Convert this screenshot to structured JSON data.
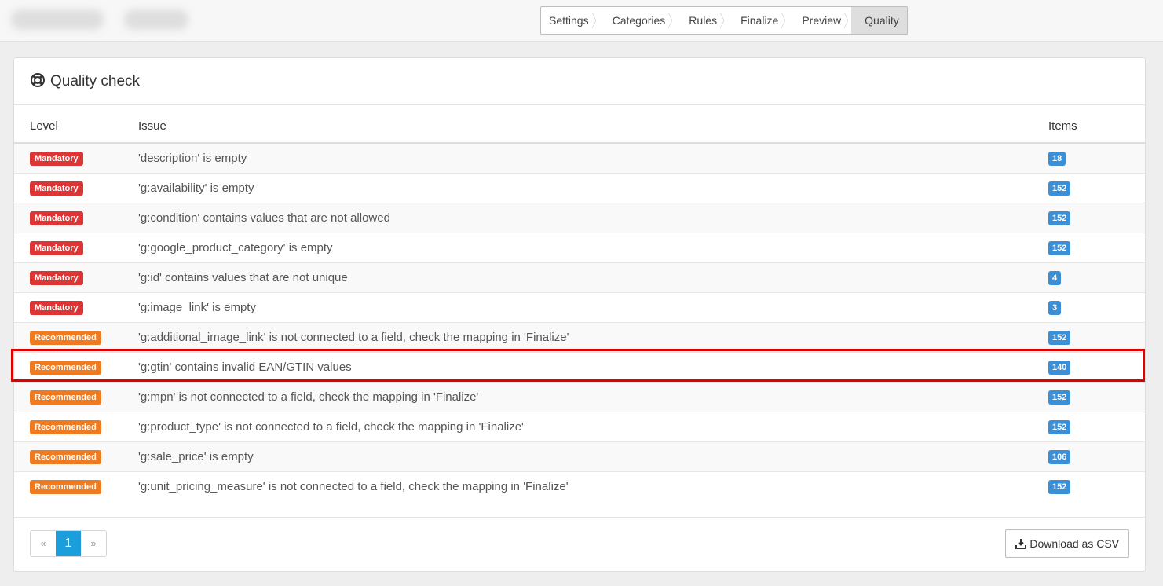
{
  "steps": [
    "Settings",
    "Categories",
    "Rules",
    "Finalize",
    "Preview",
    "Quality"
  ],
  "active_step": "Quality",
  "panel": {
    "title": "Quality check",
    "icon": "lifebuoy-icon"
  },
  "table": {
    "headers": {
      "level": "Level",
      "issue": "Issue",
      "items": "Items"
    },
    "rows": [
      {
        "level": "Mandatory",
        "issue": "'description' is empty",
        "items": "18"
      },
      {
        "level": "Mandatory",
        "issue": "'g:availability' is empty",
        "items": "152"
      },
      {
        "level": "Mandatory",
        "issue": "'g:condition' contains values that are not allowed",
        "items": "152"
      },
      {
        "level": "Mandatory",
        "issue": "'g:google_product_category' is empty",
        "items": "152"
      },
      {
        "level": "Mandatory",
        "issue": "'g:id' contains values that are not unique",
        "items": "4"
      },
      {
        "level": "Mandatory",
        "issue": "'g:image_link' is empty",
        "items": "3"
      },
      {
        "level": "Recommended",
        "issue": "'g:additional_image_link' is not connected to a field, check the mapping in 'Finalize'",
        "items": "152"
      },
      {
        "level": "Recommended",
        "issue": "'g:gtin' contains invalid EAN/GTIN values",
        "items": "140"
      },
      {
        "level": "Recommended",
        "issue": "'g:mpn' is not connected to a field, check the mapping in 'Finalize'",
        "items": "152"
      },
      {
        "level": "Recommended",
        "issue": "'g:product_type' is not connected to a field, check the mapping in 'Finalize'",
        "items": "152"
      },
      {
        "level": "Recommended",
        "issue": "'g:sale_price' is empty",
        "items": "106"
      },
      {
        "level": "Recommended",
        "issue": "'g:unit_pricing_measure' is not connected to a field, check the mapping in 'Finalize'",
        "items": "152"
      }
    ]
  },
  "pagination": {
    "prev": "«",
    "current": "1",
    "next": "»"
  },
  "download_button": "Download as CSV",
  "colors": {
    "mandatory": "#dd3535",
    "recommended": "#ee7b22",
    "count": "#3a8fd6",
    "page_active": "#1a9fdc",
    "highlight": "#e00000"
  }
}
